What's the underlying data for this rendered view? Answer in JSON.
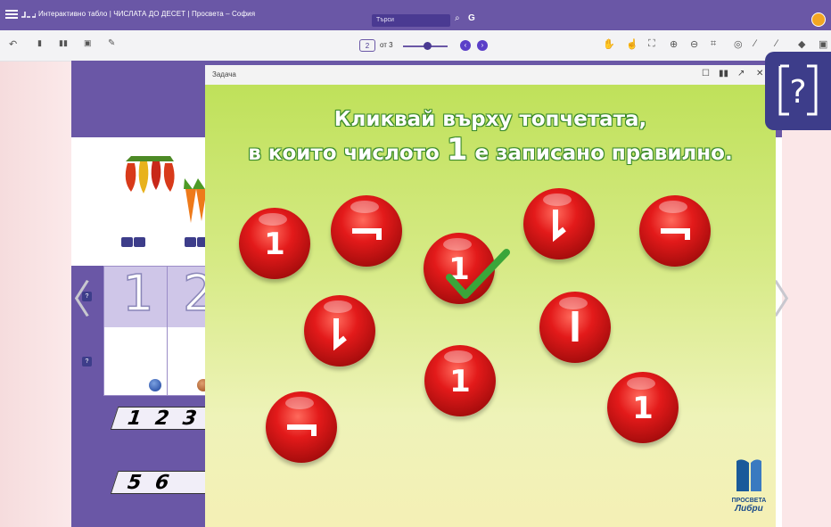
{
  "app": {
    "title": "Интерактивно табло | ЧИСЛАТА ДО ДЕСЕТ | Просвета – София"
  },
  "search": {
    "placeholder": "Търси"
  },
  "toolbar": {
    "page_current": "2",
    "page_total": "от 3"
  },
  "book": {
    "tape1_text": "1 2 3",
    "tape2_text": "5 6"
  },
  "panel": {
    "title": "Задача"
  },
  "task": {
    "line1": "Кликвай върху топчетата,",
    "line2_pre": "в които числото",
    "line2_num": "1",
    "line2_post": "е записано правилно."
  },
  "balls": [
    {
      "label": "1",
      "variant": "correct",
      "selected": false
    },
    {
      "label": "1",
      "variant": "rotated-90",
      "selected": false
    },
    {
      "label": "1",
      "variant": "correct",
      "selected": true
    },
    {
      "label": "1",
      "variant": "mirrored",
      "selected": false
    },
    {
      "label": "1",
      "variant": "rotated-90",
      "selected": false
    },
    {
      "label": "1",
      "variant": "mirrored",
      "selected": false
    },
    {
      "label": "1",
      "variant": "plain-line",
      "selected": false
    },
    {
      "label": "1",
      "variant": "correct",
      "selected": false
    },
    {
      "label": "1",
      "variant": "correct",
      "selected": false
    },
    {
      "label": "1",
      "variant": "rotated-90",
      "selected": false
    }
  ],
  "brand": {
    "line1": "ПРОСВЕТА",
    "line2": "Либри"
  },
  "help": {
    "symbol": "?"
  },
  "colors": {
    "accent": "#6a57a6",
    "ball": "#e31a1a",
    "check": "#3aa53a",
    "helpbg": "#3d3d8a"
  }
}
